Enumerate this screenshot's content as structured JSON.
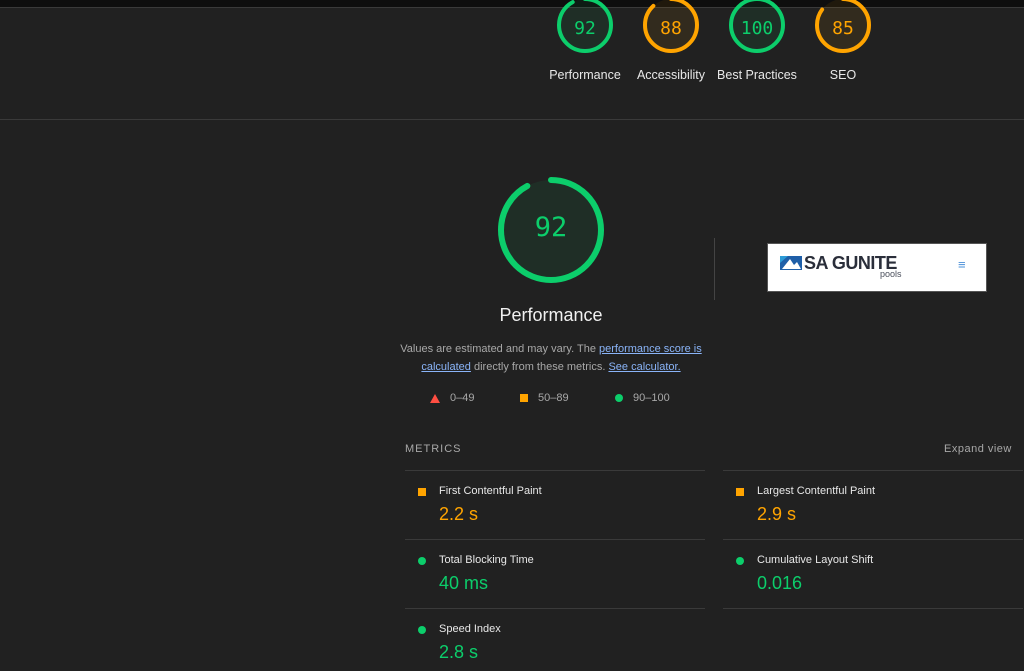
{
  "colors": {
    "pass": "#0cce6b",
    "average": "#ffa400",
    "fail": "#ff4e42",
    "link": "#8ab4f8"
  },
  "top_scores": [
    {
      "value": "92",
      "label": "Performance",
      "score": 92,
      "color": "#0cce6b"
    },
    {
      "value": "88",
      "label": "Accessibility",
      "score": 88,
      "color": "#ffa400"
    },
    {
      "value": "100",
      "label": "Best Practices",
      "score": 100,
      "color": "#0cce6b"
    },
    {
      "value": "85",
      "label": "SEO",
      "score": 85,
      "color": "#ffa400"
    }
  ],
  "performance": {
    "score_text": "92",
    "score": 92,
    "title": "Performance",
    "desc_pre": "Values are estimated and may vary. The ",
    "desc_link1": "performance score is calculated",
    "desc_mid": " directly from these metrics. ",
    "desc_link2": "See calculator."
  },
  "legend": [
    {
      "icon": "triangle-icon",
      "label": "0–49"
    },
    {
      "icon": "square-icon",
      "label": "50–89"
    },
    {
      "icon": "circle-icon",
      "label": "90–100"
    }
  ],
  "screenshot": {
    "logo_text": "SA GUNITE",
    "logo_sub": "pools",
    "menu_icon": "hamburger-icon"
  },
  "metrics": {
    "heading": "METRICS",
    "expand_label": "Expand view",
    "items": [
      {
        "name": "First Contentful Paint",
        "value": "2.2 s",
        "status_icon": "square-icon"
      },
      {
        "name": "Largest Contentful Paint",
        "value": "2.9 s",
        "status_icon": "square-icon"
      },
      {
        "name": "Total Blocking Time",
        "value": "40 ms",
        "status_icon": "circle-icon"
      },
      {
        "name": "Cumulative Layout Shift",
        "value": "0.016",
        "status_icon": "circle-icon"
      },
      {
        "name": "Speed Index",
        "value": "2.8 s",
        "status_icon": "circle-icon"
      }
    ]
  }
}
